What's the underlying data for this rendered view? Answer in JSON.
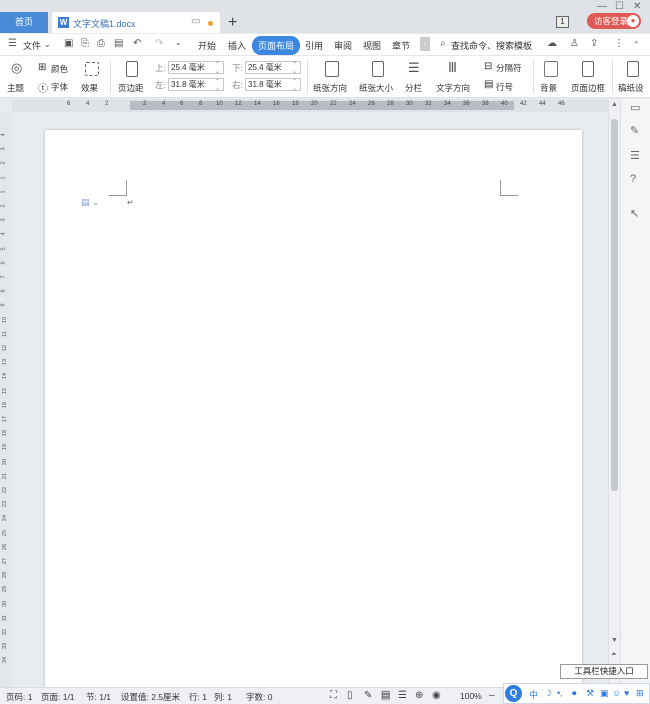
{
  "tabs": {
    "home": "首页",
    "doc_name": "文字文稿1.docx",
    "badge": "1",
    "login": "访客登录"
  },
  "menu": {
    "file": "文件",
    "items": [
      "开始",
      "插入",
      "页面布局",
      "引用",
      "审阅",
      "视图",
      "章节"
    ],
    "active_index": 2,
    "search": "查找命令、搜索模板"
  },
  "ribbon": {
    "theme": "主题",
    "color": "颜色",
    "font": "字体",
    "effect": "效果",
    "margin": "页边距",
    "top_label": "上:",
    "top_val": "25.4 毫米",
    "bottom_label": "下:",
    "bottom_val": "25.4 毫米",
    "left_label": "左:",
    "left_val": "31.8 毫米",
    "right_label": "右:",
    "right_val": "31.8 毫米",
    "orientation": "纸张方向",
    "size": "纸张大小",
    "columns": "分栏",
    "text_dir": "文字方向",
    "separator": "分隔符",
    "line_num": "行号",
    "background": "背景",
    "page_border": "页面边框",
    "manuscript": "稿纸设"
  },
  "ruler_ticks": [
    "6",
    "4",
    "2",
    "2",
    "4",
    "6",
    "8",
    "10",
    "12",
    "14",
    "16",
    "18",
    "20",
    "22",
    "24",
    "26",
    "28",
    "30",
    "32",
    "34",
    "36",
    "38",
    "40",
    "42",
    "44",
    "46"
  ],
  "vruler_marks": [
    "4",
    "3",
    "2",
    "1",
    "1",
    "2",
    "3",
    "4",
    "5",
    "6",
    "7",
    "8",
    "9",
    "10",
    "11",
    "12",
    "13",
    "14",
    "15",
    "16",
    "17",
    "18",
    "19",
    "20",
    "21",
    "22",
    "23",
    "24",
    "25",
    "26",
    "27",
    "28",
    "29",
    "30",
    "31",
    "32",
    "33",
    "34"
  ],
  "tooltip": "工具栏快捷入口",
  "status": {
    "page_num": "页码: 1",
    "pages": "页面: 1/1",
    "section": "节: 1/1",
    "setting": "设置值: 2.5厘米",
    "row": "行: 1",
    "col": "列: 1",
    "words": "字数: 0",
    "zoom": "100%"
  },
  "ime": {
    "lang": "中"
  }
}
